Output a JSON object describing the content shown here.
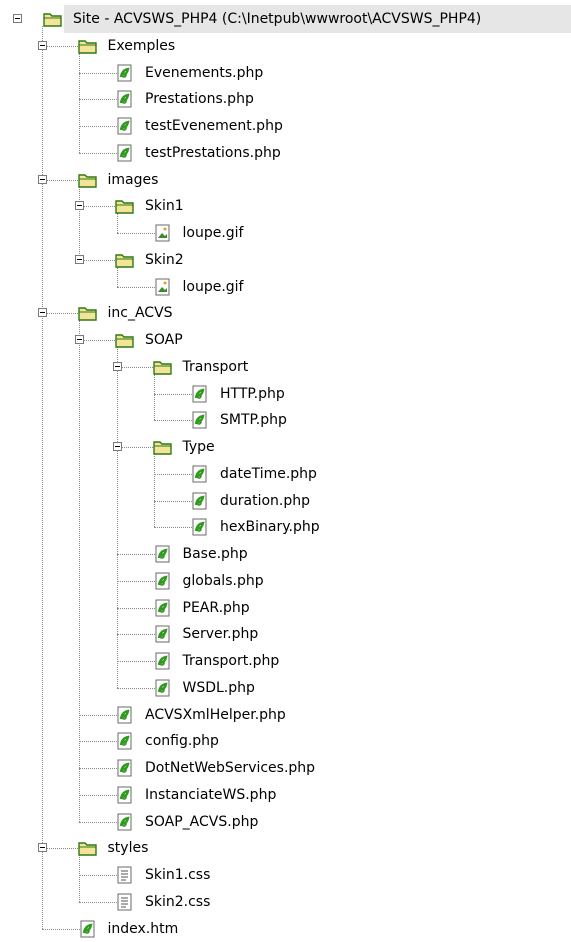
{
  "tree": {
    "rows": [
      {
        "label": "Site - ACVSWS_PHP4 (C:\\Inetpub\\wwwroot\\ACVSWS_PHP4)",
        "icon": "folder-icon",
        "depth": 0,
        "expander": true
      },
      {
        "label": "Exemples",
        "icon": "folder-icon",
        "depth": 1,
        "expander": true
      },
      {
        "label": "Evenements.php",
        "icon": "php-file-icon",
        "depth": 2,
        "expander": false
      },
      {
        "label": "Prestations.php",
        "icon": "php-file-icon",
        "depth": 2,
        "expander": false
      },
      {
        "label": "testEvenement.php",
        "icon": "php-file-icon",
        "depth": 2,
        "expander": false
      },
      {
        "label": "testPrestations.php",
        "icon": "php-file-icon",
        "depth": 2,
        "expander": false
      },
      {
        "label": "images",
        "icon": "folder-icon",
        "depth": 1,
        "expander": true
      },
      {
        "label": "Skin1",
        "icon": "folder-icon",
        "depth": 2,
        "expander": true
      },
      {
        "label": "loupe.gif",
        "icon": "image-file-icon",
        "depth": 3,
        "expander": false
      },
      {
        "label": "Skin2",
        "icon": "folder-icon",
        "depth": 2,
        "expander": true
      },
      {
        "label": "loupe.gif",
        "icon": "image-file-icon",
        "depth": 3,
        "expander": false
      },
      {
        "label": "inc_ACVS",
        "icon": "folder-icon",
        "depth": 1,
        "expander": true
      },
      {
        "label": "SOAP",
        "icon": "folder-icon",
        "depth": 2,
        "expander": true
      },
      {
        "label": "Transport",
        "icon": "folder-icon",
        "depth": 3,
        "expander": true
      },
      {
        "label": "HTTP.php",
        "icon": "php-file-icon",
        "depth": 4,
        "expander": false
      },
      {
        "label": "SMTP.php",
        "icon": "php-file-icon",
        "depth": 4,
        "expander": false
      },
      {
        "label": "Type",
        "icon": "folder-icon",
        "depth": 3,
        "expander": true
      },
      {
        "label": "dateTime.php",
        "icon": "php-file-icon",
        "depth": 4,
        "expander": false
      },
      {
        "label": "duration.php",
        "icon": "php-file-icon",
        "depth": 4,
        "expander": false
      },
      {
        "label": "hexBinary.php",
        "icon": "php-file-icon",
        "depth": 4,
        "expander": false
      },
      {
        "label": "Base.php",
        "icon": "php-file-icon",
        "depth": 3,
        "expander": false
      },
      {
        "label": "globals.php",
        "icon": "php-file-icon",
        "depth": 3,
        "expander": false
      },
      {
        "label": "PEAR.php",
        "icon": "php-file-icon",
        "depth": 3,
        "expander": false
      },
      {
        "label": "Server.php",
        "icon": "php-file-icon",
        "depth": 3,
        "expander": false
      },
      {
        "label": "Transport.php",
        "icon": "php-file-icon",
        "depth": 3,
        "expander": false
      },
      {
        "label": "WSDL.php",
        "icon": "php-file-icon",
        "depth": 3,
        "expander": false
      },
      {
        "label": "ACVSXmlHelper.php",
        "icon": "php-file-icon",
        "depth": 2,
        "expander": false
      },
      {
        "label": "config.php",
        "icon": "php-file-icon",
        "depth": 2,
        "expander": false
      },
      {
        "label": "DotNetWebServices.php",
        "icon": "php-file-icon",
        "depth": 2,
        "expander": false
      },
      {
        "label": "InstanciateWS.php",
        "icon": "php-file-icon",
        "depth": 2,
        "expander": false
      },
      {
        "label": "SOAP_ACVS.php",
        "icon": "php-file-icon",
        "depth": 2,
        "expander": false
      },
      {
        "label": "styles",
        "icon": "folder-icon",
        "depth": 1,
        "expander": true
      },
      {
        "label": "Skin1.css",
        "icon": "css-file-icon",
        "depth": 2,
        "expander": false
      },
      {
        "label": "Skin2.css",
        "icon": "css-file-icon",
        "depth": 2,
        "expander": false
      },
      {
        "label": "index.htm",
        "icon": "php-file-icon",
        "depth": 1,
        "expander": false
      }
    ]
  },
  "colors": {
    "folder_fill": "#f3e49a",
    "folder_edge": "#2d7a14",
    "php_green": "#2f9a1e",
    "selection_bg": "#e6e6e6"
  }
}
